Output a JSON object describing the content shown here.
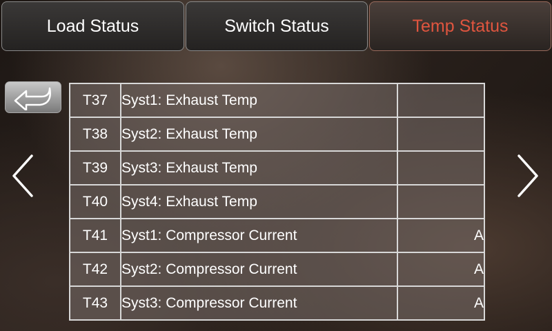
{
  "tabs": [
    {
      "label": "Load Status",
      "active": false
    },
    {
      "label": "Switch Status",
      "active": false
    },
    {
      "label": "Temp Status",
      "active": true
    }
  ],
  "colors": {
    "active_tab": "#e0553f",
    "text": "#ffffff",
    "grid_line": "#d8d8d8"
  },
  "icons": {
    "back": "return-arrow-icon",
    "prev": "chevron-left-icon",
    "next": "chevron-right-icon"
  },
  "rows": [
    {
      "id": "T37",
      "name": "Syst1: Exhaust Temp",
      "unit": ""
    },
    {
      "id": "T38",
      "name": "Syst2: Exhaust Temp",
      "unit": ""
    },
    {
      "id": "T39",
      "name": "Syst3: Exhaust Temp",
      "unit": ""
    },
    {
      "id": "T40",
      "name": "Syst4: Exhaust Temp",
      "unit": ""
    },
    {
      "id": "T41",
      "name": "Syst1: Compressor Current",
      "unit": "A"
    },
    {
      "id": "T42",
      "name": "Syst2: Compressor Current",
      "unit": "A"
    },
    {
      "id": "T43",
      "name": "Syst3: Compressor Current",
      "unit": "A"
    }
  ]
}
